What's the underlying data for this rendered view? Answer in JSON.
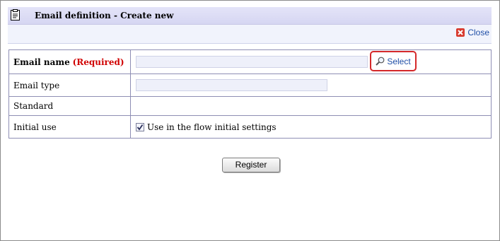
{
  "dialog": {
    "title": "Email definition - Create new",
    "close_label": "Close"
  },
  "form": {
    "rows": [
      {
        "label": "Email name",
        "required_label": "(Required)",
        "value": "",
        "action_label": "Select"
      },
      {
        "label": "Email type",
        "value": ""
      },
      {
        "label": "Standard",
        "value": ""
      },
      {
        "label": "Initial use",
        "checkbox_label": "Use in the flow initial settings",
        "checked": true
      }
    ]
  },
  "actions": {
    "register_label": "Register"
  },
  "colors": {
    "title_bar": "#dcdcf4",
    "required": "#d00000",
    "link": "#1f4ea6",
    "highlight_border": "#d4282a"
  },
  "icons": {
    "title": "clipboard-icon",
    "close": "close-x-icon",
    "select": "magnifier-icon",
    "checkbox": "checkmark-icon"
  }
}
